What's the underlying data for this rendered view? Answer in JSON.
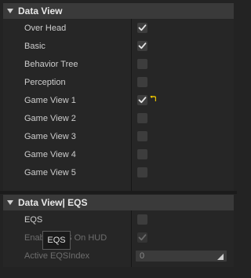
{
  "sections": [
    {
      "title": "Data View",
      "rows": [
        {
          "label": "Over Head",
          "checked": true
        },
        {
          "label": "Basic",
          "checked": true
        },
        {
          "label": "Behavior Tree",
          "checked": false
        },
        {
          "label": "Perception",
          "checked": false
        },
        {
          "label": "Game View 1",
          "checked": true,
          "reset_to_default": true
        },
        {
          "label": "Game View 2",
          "checked": false
        },
        {
          "label": "Game View 3",
          "checked": false
        },
        {
          "label": "Game View 4",
          "checked": false
        },
        {
          "label": "Game View 5",
          "checked": false
        }
      ]
    },
    {
      "title": "Data View| EQS",
      "rows": [
        {
          "label": "EQS",
          "checked": false
        },
        {
          "label": "Enable EQS On HUD",
          "checked": true,
          "disabled": true
        },
        {
          "label": "Active EQSIndex",
          "value": "0",
          "disabled": true
        }
      ]
    }
  ],
  "tooltip": {
    "text": "EQS"
  },
  "colors": {
    "checkmark": "#e6e6e6",
    "reset_icon": "#e6c000"
  }
}
